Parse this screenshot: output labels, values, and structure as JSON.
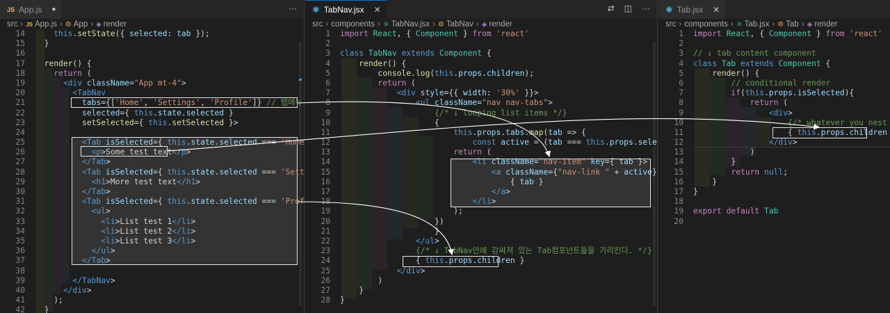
{
  "editors": [
    {
      "tab": {
        "name": "App.js",
        "icon": "JS",
        "modified": true
      },
      "breadcrumb": [
        "src",
        "App.js",
        "App",
        "render"
      ],
      "lines": [
        {
          "n": "14",
          "t": "    this.setState({ selected: tab });"
        },
        {
          "n": "15",
          "t": "  }"
        },
        {
          "n": "16",
          "t": ""
        },
        {
          "n": "17",
          "t": "  render() {"
        },
        {
          "n": "18",
          "t": "    return ("
        },
        {
          "n": "19",
          "t": "      <div className=\"App mt-4\">"
        },
        {
          "n": "20",
          "t": "        <TabNav"
        },
        {
          "n": "21",
          "t": "          tabs={['Home', 'Settings', 'Profile']} // 탭메뉴 이름들"
        },
        {
          "n": "22",
          "t": "          selected={ this.state.selected }"
        },
        {
          "n": "23",
          "t": "          setSelected={ this.setSelected }>"
        },
        {
          "n": "24",
          "t": ""
        },
        {
          "n": "25",
          "t": "          <Tab isSelected={ this.state.selected === 'Home' }>"
        },
        {
          "n": "26",
          "t": "            <p>Some test text</p>"
        },
        {
          "n": "27",
          "t": "          </Tab>"
        },
        {
          "n": "28",
          "t": "          <Tab isSelected={ this.state.selected === 'Settings' }>"
        },
        {
          "n": "29",
          "t": "            <h1>More test text</h1>"
        },
        {
          "n": "30",
          "t": "          </Tab>"
        },
        {
          "n": "31",
          "t": "          <Tab isSelected={ this.state.selected === 'Profile' }>"
        },
        {
          "n": "32",
          "t": "            <ul>"
        },
        {
          "n": "33",
          "t": "              <li>List test 1</li>"
        },
        {
          "n": "34",
          "t": "              <li>List test 2</li>"
        },
        {
          "n": "35",
          "t": "              <li>List test 3</li>"
        },
        {
          "n": "36",
          "t": "            </ul>"
        },
        {
          "n": "37",
          "t": "          </Tab>"
        },
        {
          "n": "38",
          "t": ""
        },
        {
          "n": "39",
          "t": "        </TabNav>"
        },
        {
          "n": "40",
          "t": "      </div>"
        },
        {
          "n": "41",
          "t": "    );"
        },
        {
          "n": "42",
          "t": "  }"
        }
      ]
    },
    {
      "tab": {
        "name": "TabNav.jsx",
        "icon": "react"
      },
      "breadcrumb": [
        "src",
        "components",
        "TabNav.jsx",
        "TabNav",
        "render"
      ],
      "lines": [
        {
          "n": "1",
          "t": "import React, { Component } from 'react'"
        },
        {
          "n": "2",
          "t": ""
        },
        {
          "n": "3",
          "t": "class TabNav extends Component {"
        },
        {
          "n": "4",
          "t": "    render() {"
        },
        {
          "n": "5",
          "t": "        console.log(this.props.children);"
        },
        {
          "n": "6",
          "t": "        return ("
        },
        {
          "n": "7",
          "t": "            <div style={{ width: '30%' }}>"
        },
        {
          "n": "8",
          "t": "                <ul className=\"nav nav-tabs\">"
        },
        {
          "n": "9",
          "t": "                    {/* ↓ looping list items */}"
        },
        {
          "n": "10",
          "t": "                    {"
        },
        {
          "n": "11",
          "t": "                        this.props.tabs.map(tab => {"
        },
        {
          "n": "12",
          "t": "                            const active = (tab === this.props.selected"
        },
        {
          "n": "13",
          "t": "                        return ("
        },
        {
          "n": "14",
          "t": "                            <li className=\"nav-item\" key={ tab }>"
        },
        {
          "n": "15",
          "t": "                                <a className={\"nav-link \" + active} onClick={ ("
        },
        {
          "n": "16",
          "t": "                                    { tab }"
        },
        {
          "n": "17",
          "t": "                                </a>"
        },
        {
          "n": "18",
          "t": "                            </li>"
        },
        {
          "n": "19",
          "t": "                        );"
        },
        {
          "n": "20",
          "t": "                    })"
        },
        {
          "n": "21",
          "t": "                    }"
        },
        {
          "n": "22",
          "t": "                </ul>"
        },
        {
          "n": "23",
          "t": "                {/* ↓ TabNav안에 감싸져 있는 Tab컴포넌트들을 가리킨다. */}"
        },
        {
          "n": "24",
          "t": "                { this.props.children }"
        },
        {
          "n": "25",
          "t": "            </div>"
        },
        {
          "n": "26",
          "t": "        )"
        },
        {
          "n": "27",
          "t": "    }"
        },
        {
          "n": "28",
          "t": "}"
        }
      ]
    },
    {
      "tab": {
        "name": "Tab.jsx",
        "icon": "react"
      },
      "breadcrumb": [
        "src",
        "components",
        "Tab.jsx",
        "Tab",
        "render"
      ],
      "lines": [
        {
          "n": "1",
          "t": "import React, { Component } from 'react'"
        },
        {
          "n": "2",
          "t": ""
        },
        {
          "n": "3",
          "t": "// ↓ tab content component"
        },
        {
          "n": "4",
          "t": "class Tab extends Component {"
        },
        {
          "n": "5",
          "t": "    render() {"
        },
        {
          "n": "6",
          "t": "        // conditional render"
        },
        {
          "n": "7",
          "t": "        if(this.props.isSelected){"
        },
        {
          "n": "8",
          "t": "            return ("
        },
        {
          "n": "9",
          "t": "                <div>"
        },
        {
          "n": "10",
          "t": "                    {/* whatever you nest inside o"
        },
        {
          "n": "11",
          "t": "                    { this.props.children }"
        },
        {
          "n": "12",
          "t": "                </div>"
        },
        {
          "n": "13",
          "t": "            )"
        },
        {
          "n": "14",
          "t": "        }"
        },
        {
          "n": "15",
          "t": "        return null;"
        },
        {
          "n": "16",
          "t": "    }"
        },
        {
          "n": "17",
          "t": "}"
        },
        {
          "n": "18",
          "t": ""
        },
        {
          "n": "19",
          "t": "export default Tab"
        },
        {
          "n": "20",
          "t": ""
        }
      ]
    }
  ]
}
